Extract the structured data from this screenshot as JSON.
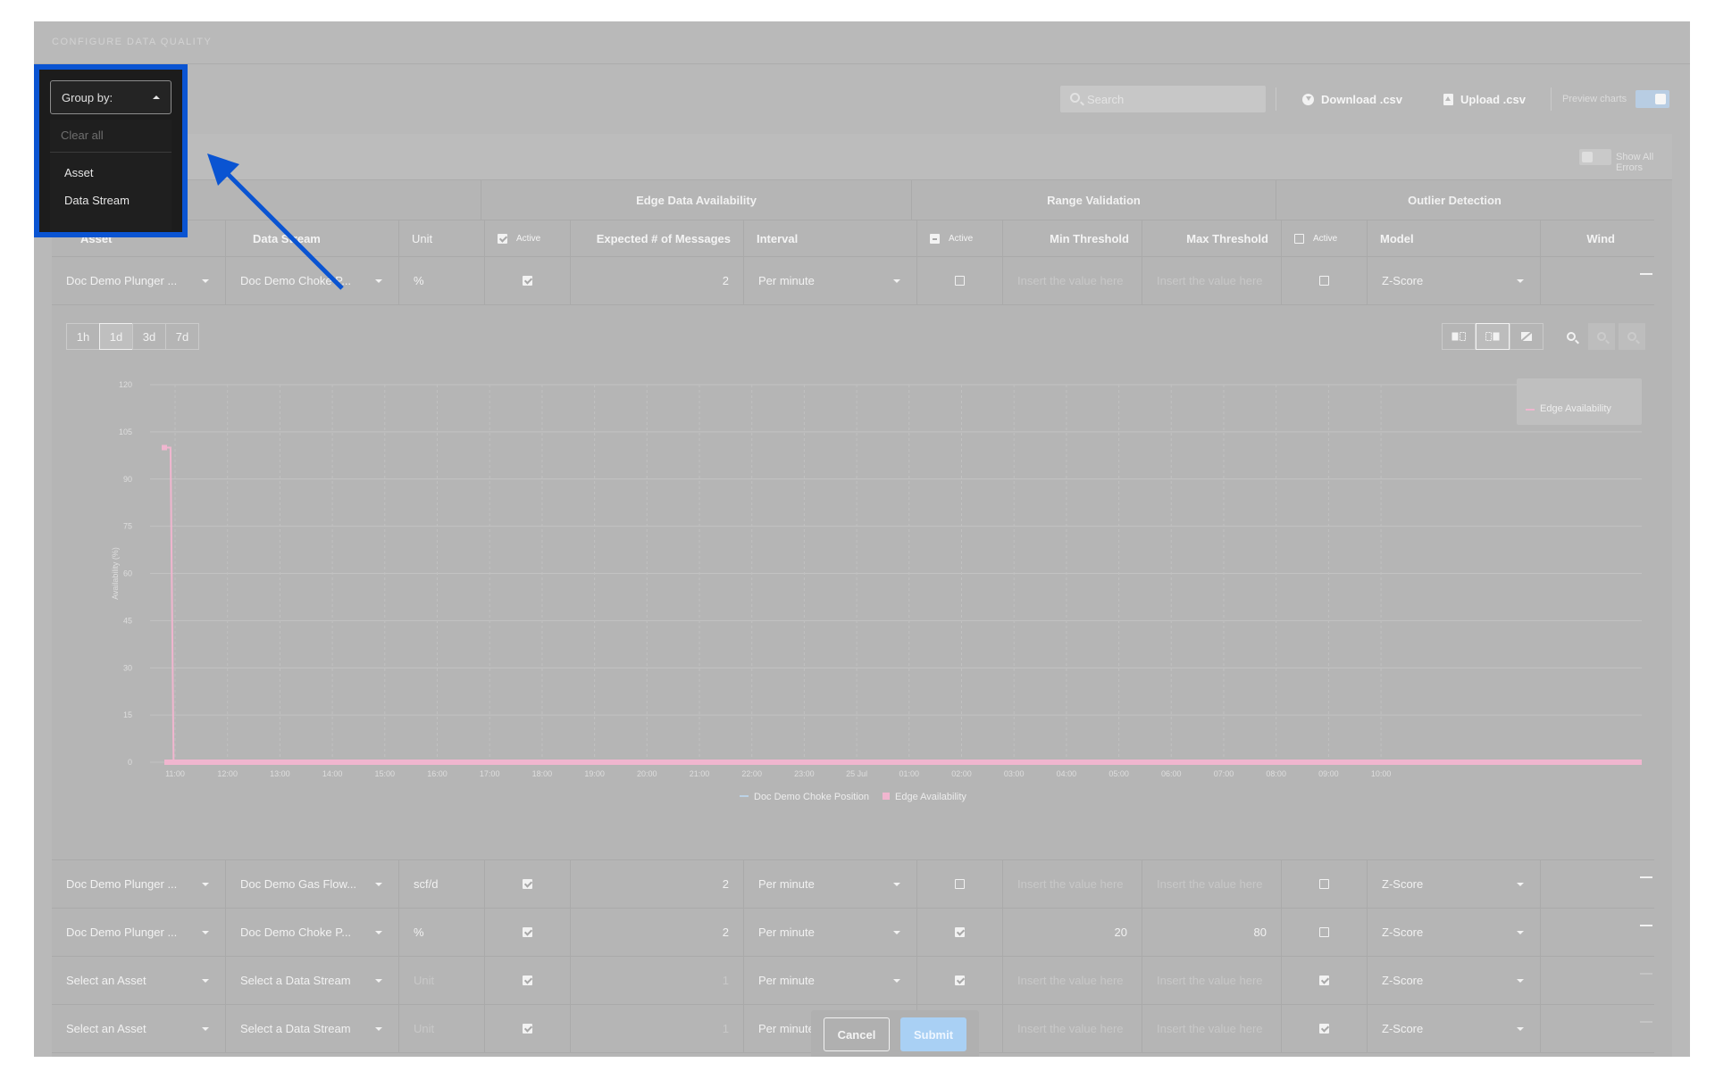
{
  "title": "CONFIGURE DATA QUALITY",
  "toolbar": {
    "search_placeholder": "Search",
    "download_label": "Download .csv",
    "upload_label": "Upload .csv",
    "preview_label": "Preview charts",
    "preview_on": true
  },
  "show_all_errors_label": "Show All Errors",
  "group_by": {
    "label": "Group by:",
    "clear_label": "Clear all",
    "options": [
      "Asset",
      "Data Stream"
    ]
  },
  "groups": {
    "edge": "Edge Data Availability",
    "range": "Range Validation",
    "outlier": "Outlier Detection"
  },
  "columns": {
    "asset": "Asset",
    "stream": "Data Stream",
    "unit": "Unit",
    "active": "Active",
    "expected": "Expected # of Messages",
    "interval": "Interval",
    "min": "Min Threshold",
    "max": "Max Threshold",
    "model": "Model",
    "window": "Wind"
  },
  "placeholders": {
    "value": "Insert the value here"
  },
  "rows": [
    {
      "asset": "Doc Demo Plunger ...",
      "stream": "Doc Demo Choke P...",
      "unit": "%",
      "edge_active": true,
      "expected": "2",
      "interval": "Per minute",
      "range_active": false,
      "min": "",
      "max": "",
      "outlier_active": false,
      "model": "Z-Score"
    },
    {
      "asset": "Doc Demo Plunger ...",
      "stream": "Doc Demo Gas Flow...",
      "unit": "scf/d",
      "edge_active": true,
      "expected": "2",
      "interval": "Per minute",
      "range_active": false,
      "min": "",
      "max": "",
      "outlier_active": false,
      "model": "Z-Score"
    },
    {
      "asset": "Doc Demo Plunger ...",
      "stream": "Doc Demo Choke P...",
      "unit": "%",
      "edge_active": true,
      "expected": "2",
      "interval": "Per minute",
      "range_active": true,
      "min": "20",
      "max": "80",
      "outlier_active": false,
      "model": "Z-Score"
    },
    {
      "asset": "Select an Asset",
      "stream": "Select a Data Stream",
      "unit": "Unit",
      "edge_active": true,
      "expected": "1",
      "interval": "Per minute",
      "range_active": true,
      "min": "",
      "max": "",
      "outlier_active": true,
      "model": "Z-Score"
    },
    {
      "asset": "Select an Asset",
      "stream": "Select a Data Stream",
      "unit": "Unit",
      "edge_active": true,
      "expected": "1",
      "interval": "Per minute",
      "range_active": true,
      "min": "",
      "max": "",
      "outlier_active": true,
      "model": "Z-Score"
    }
  ],
  "chart": {
    "ranges": [
      "1h",
      "1d",
      "3d",
      "7d"
    ],
    "selected_range": "1d",
    "legend_box_label": "Edge Availability",
    "legend": [
      "Doc Demo Choke Position",
      "Edge Availability"
    ]
  },
  "chart_data": {
    "type": "line",
    "ylabel": "Availability (%)",
    "ylim": [
      0,
      120
    ],
    "yticks": [
      120,
      105,
      90,
      75,
      60,
      45,
      30,
      15,
      0
    ],
    "x": [
      "11:00",
      "12:00",
      "13:00",
      "14:00",
      "15:00",
      "16:00",
      "17:00",
      "18:00",
      "19:00",
      "20:00",
      "21:00",
      "22:00",
      "23:00",
      "25 Jul",
      "01:00",
      "02:00",
      "03:00",
      "04:00",
      "05:00",
      "06:00",
      "07:00",
      "08:00",
      "09:00",
      "10:00"
    ],
    "series": [
      {
        "name": "Edge Availability",
        "color": "#f0b6cf",
        "points": [
          [
            0,
            100
          ],
          [
            0.1,
            100
          ],
          [
            0.15,
            0
          ],
          [
            24,
            0
          ]
        ]
      },
      {
        "name": "Doc Demo Choke Position",
        "color": "#bcd2e6",
        "points": []
      }
    ]
  },
  "actions": {
    "cancel": "Cancel",
    "submit": "Submit"
  },
  "colors": {
    "overlay": "#b9b9b9",
    "highlight": "#0a54d2",
    "submit": "#a9d0f4",
    "series": "#f0b6cf"
  }
}
